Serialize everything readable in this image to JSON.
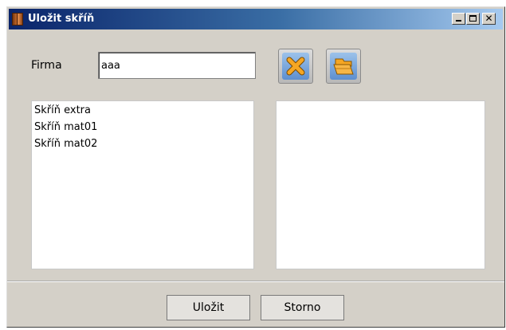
{
  "window": {
    "title": "Uložit skříň",
    "title_icon": "wardrobe-icon",
    "controls": {
      "minimize": "minimize-icon",
      "maximize": "maximize-icon",
      "close_glyph": "✕"
    }
  },
  "form": {
    "firma_label": "Firma",
    "firma_value": "aaa"
  },
  "toolbar": {
    "cancel_icon": "orange-x-icon",
    "open_icon": "folder-stack-icon"
  },
  "lists": {
    "left_items": [
      "Skříň extra",
      "Skříň mat01",
      "Skříň mat02"
    ],
    "right_items": []
  },
  "buttons": {
    "save_label": "Uložit",
    "storno_label": "Storno"
  },
  "colors": {
    "title_gradient_start": "#0a246a",
    "title_gradient_end": "#a6caf0",
    "dialog_bg": "#d4d0c8",
    "accent_orange": "#f5a623",
    "tool_button_blue": "#5d8fd0"
  }
}
